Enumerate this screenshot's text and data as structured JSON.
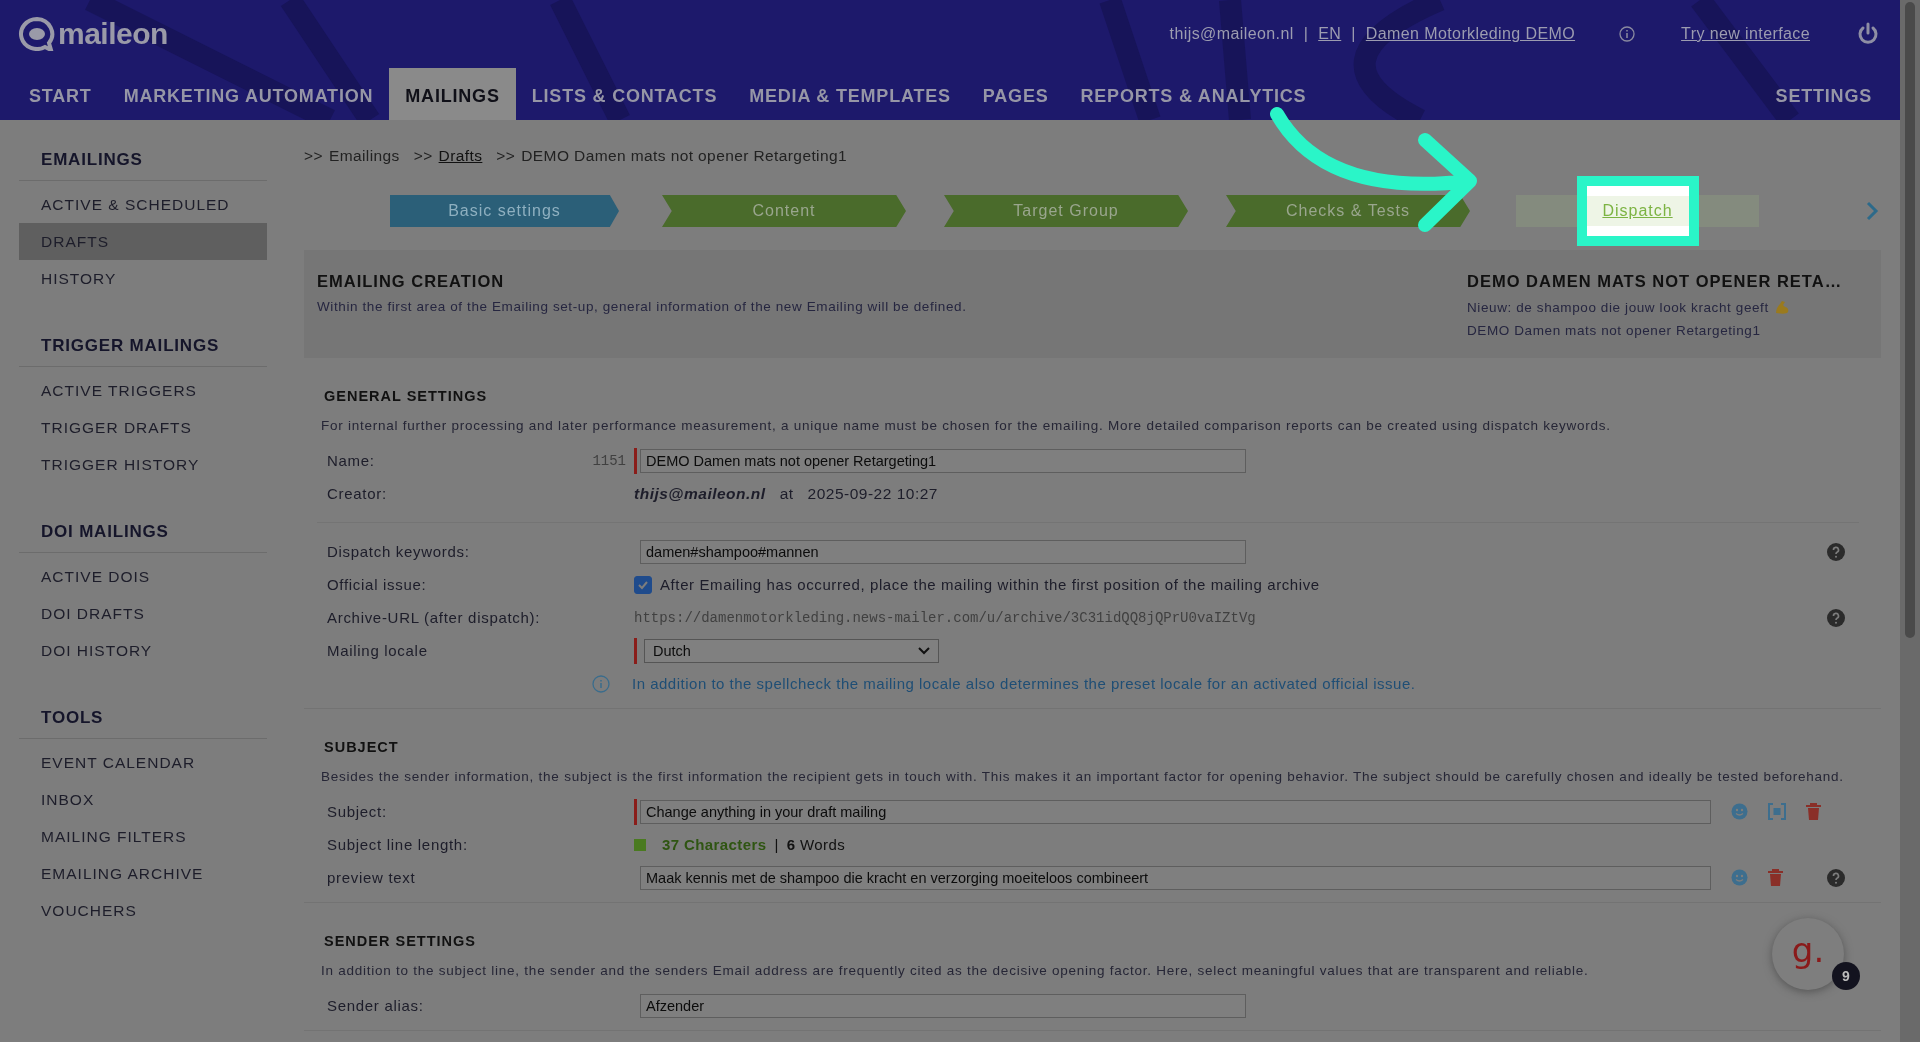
{
  "header": {
    "logo": "maileon",
    "links": [
      {
        "text": "thijs@maileon.nl",
        "kind": "text"
      },
      {
        "text": "|",
        "kind": "separator"
      },
      {
        "text": "EN",
        "kind": "link"
      },
      {
        "text": "|",
        "kind": "separator"
      },
      {
        "text": "Damen Motorkleding DEMO",
        "kind": "link"
      }
    ],
    "try_new": "Try new interface"
  },
  "nav": [
    {
      "label": "START",
      "selected": false
    },
    {
      "label": "MARKETING AUTOMATION",
      "selected": false
    },
    {
      "label": "MAILINGS",
      "selected": true
    },
    {
      "label": "LISTS & CONTACTS",
      "selected": false
    },
    {
      "label": "MEDIA & TEMPLATES",
      "selected": false
    },
    {
      "label": "PAGES",
      "selected": false
    },
    {
      "label": "REPORTS & ANALYTICS",
      "selected": false
    }
  ],
  "nav_right": {
    "label": "SETTINGS",
    "selected": false
  },
  "sidebar": [
    {
      "title": "EMAILINGS",
      "items": [
        {
          "label": "ACTIVE & SCHEDULED",
          "selected": false
        },
        {
          "label": "DRAFTS",
          "selected": true
        },
        {
          "label": "HISTORY",
          "selected": false
        }
      ]
    },
    {
      "title": "TRIGGER MAILINGS",
      "items": [
        {
          "label": "ACTIVE TRIGGERS",
          "selected": false
        },
        {
          "label": "TRIGGER DRAFTS",
          "selected": false
        },
        {
          "label": "TRIGGER HISTORY",
          "selected": false
        }
      ]
    },
    {
      "title": "DOI MAILINGS",
      "items": [
        {
          "label": "ACTIVE DOIS",
          "selected": false
        },
        {
          "label": "DOI DRAFTS",
          "selected": false
        },
        {
          "label": "DOI HISTORY",
          "selected": false
        }
      ]
    },
    {
      "title": "TOOLS",
      "items": [
        {
          "label": "EVENT CALENDAR",
          "selected": false
        },
        {
          "label": "INBOX",
          "selected": false
        },
        {
          "label": "MAILING FILTERS",
          "selected": false
        },
        {
          "label": "EMAILING ARCHIVE",
          "selected": false
        },
        {
          "label": "VOUCHERS",
          "selected": false
        }
      ]
    }
  ],
  "breadcrumb": [
    {
      "prefix": ">>",
      "label": "Emailings",
      "link": false
    },
    {
      "prefix": ">>",
      "label": "Drafts",
      "link": true
    },
    {
      "prefix": ">>",
      "label": "DEMO Damen mats not opener Retargeting1",
      "link": false
    }
  ],
  "steps": [
    {
      "label": "Basic settings",
      "current": true,
      "done": false,
      "highlighted": false
    },
    {
      "label": "Content",
      "current": false,
      "done": true,
      "highlighted": false
    },
    {
      "label": "Target Group",
      "current": false,
      "done": true,
      "highlighted": false
    },
    {
      "label": "Checks & Tests",
      "current": false,
      "done": true,
      "highlighted": false
    },
    {
      "label": "Dispatch",
      "current": false,
      "done": false,
      "highlighted": true
    }
  ],
  "intro": {
    "title": "EMAILING CREATION",
    "text": "Within the first area of the Emailing set-up, general information of the new Emailing will be defined.",
    "summary_title": "DEMO DAMEN MATS NOT OPENER RETA…",
    "summary_lines": [
      {
        "text": "Nieuw: de shampoo die jouw look kracht geeft",
        "emoji": true
      },
      {
        "text": "DEMO Damen mats not opener Retargeting1",
        "emoji": false
      }
    ]
  },
  "sections": [
    {
      "title": "GENERAL SETTINGS",
      "text": "For internal further processing and later performance measurement, a unique name must be chosen for the emailing. More detailed comparison reports can be created using dispatch keywords.",
      "rows": [
        {
          "kind": "input",
          "label": "Name:",
          "number": "1151",
          "value": "DEMO Damen mats not opener Retargeting1",
          "required": true,
          "help": false
        },
        {
          "kind": "creator",
          "label": "Creator:",
          "email": "thijs@maileon.nl",
          "at": "at",
          "date": "2025-09-22 10:27",
          "help": false
        },
        {
          "kind": "divider"
        },
        {
          "kind": "input",
          "label": "Dispatch keywords:",
          "value": "damen#shampoo#mannen",
          "required": false,
          "help": true
        },
        {
          "kind": "checkbox",
          "label": "Official issue:",
          "checked": true,
          "text": "After Emailing has occurred, place the mailing within the first position of the mailing archive",
          "help": false
        },
        {
          "kind": "url",
          "label": "Archive-URL (after dispatch):",
          "value": "https://damenmotorkleding.news-mailer.com/u/archive/3C31idQQ8jQPrU0vaIZtVg",
          "help": true
        },
        {
          "kind": "select",
          "label": "Mailing locale",
          "value": "Dutch",
          "required": true,
          "help": false
        },
        {
          "kind": "note",
          "text": "In addition to the spellcheck the mailing locale also determines the preset locale for an activated official issue."
        }
      ]
    },
    {
      "title": "SUBJECT",
      "text": "Besides the sender information, the subject is the first information the recipient gets in touch with. This makes it an important factor for opening behavior. The subject should be carefully chosen and ideally be tested beforehand.",
      "rows": [
        {
          "kind": "wide_input",
          "label": "Subject:",
          "value": "Change anything in your draft mailing",
          "required": true,
          "emoji_button": true,
          "placeholder_button": true,
          "delete_button": true,
          "help": false
        },
        {
          "kind": "length",
          "label": "Subject line length:",
          "count": "37 Characters",
          "separator": "|",
          "words": "**6** Words",
          "help": false
        },
        {
          "kind": "wide_input",
          "label": "preview text",
          "value": "Maak kennis met de shampoo die kracht en verzorging moeiteloos combineert",
          "required": false,
          "emoji_button": true,
          "placeholder_button": false,
          "delete_button": true,
          "help": true
        }
      ]
    },
    {
      "title": "SENDER SETTINGS",
      "text": "In addition to the subject line, the sender and the senders Email address are frequently cited as the decisive opening factor. Here, select meaningful values that are transparent and reliable.",
      "rows": [
        {
          "kind": "input",
          "label": "Sender alias:",
          "value": "Afzender",
          "required": false,
          "help": false
        }
      ]
    }
  ],
  "chat": {
    "letter": "g.",
    "badge": "9"
  }
}
